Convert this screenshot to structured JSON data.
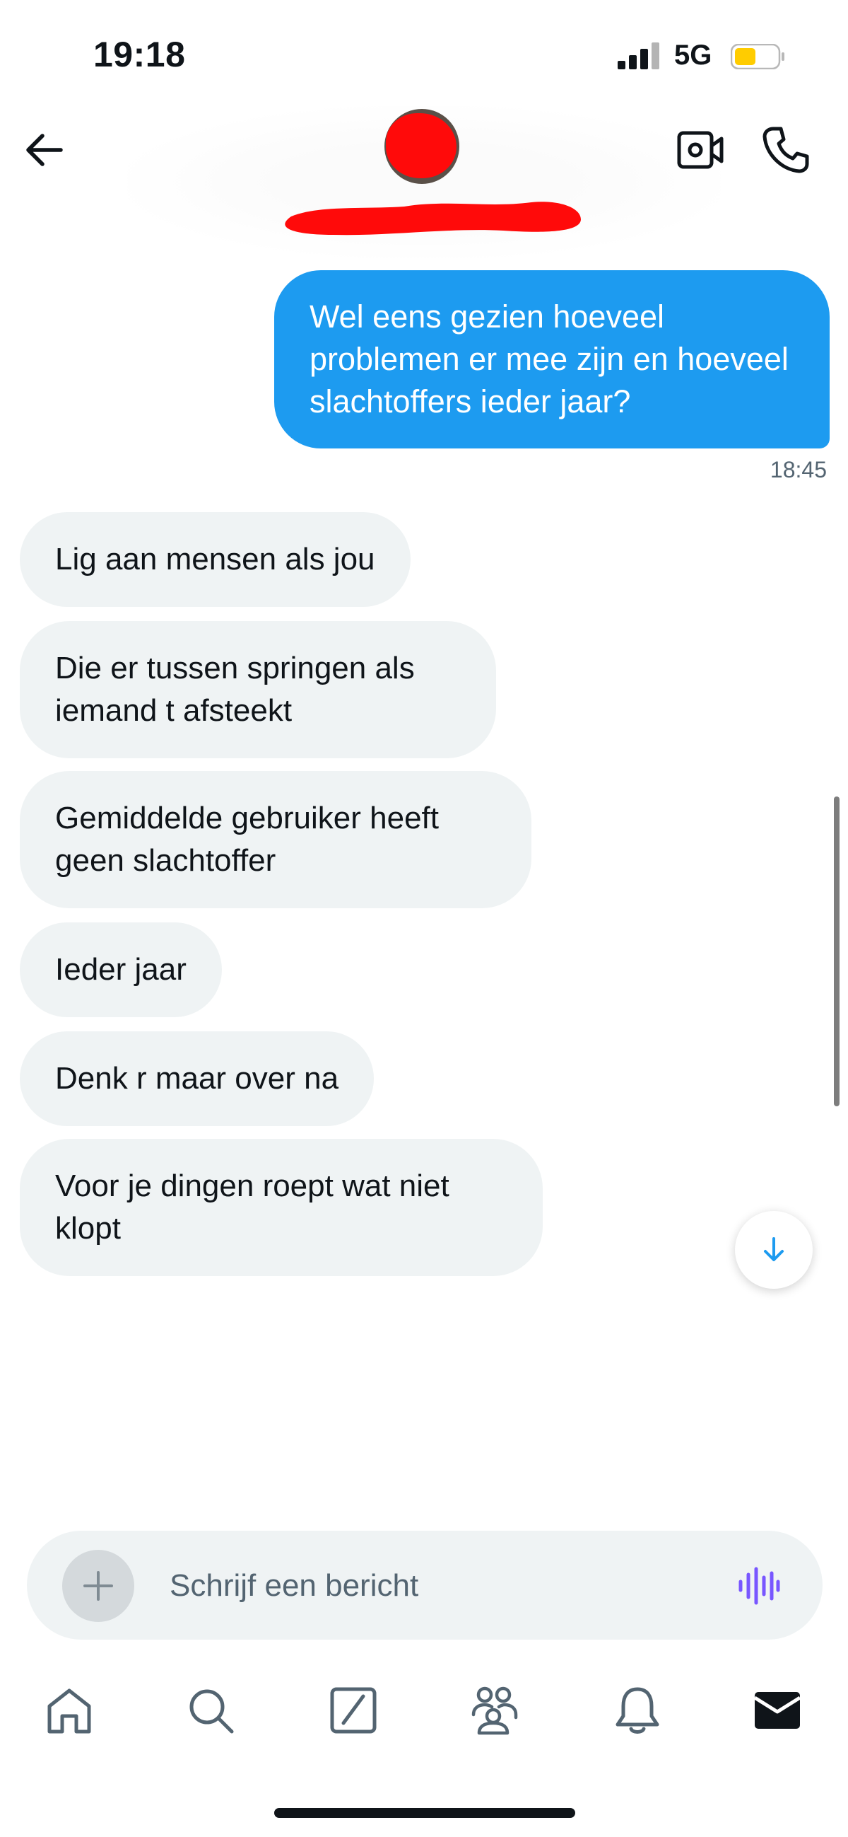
{
  "status_bar": {
    "time": "19:18",
    "network": "5G",
    "battery_level": 0.5,
    "battery_color": "#ffcc00"
  },
  "header": {
    "back_icon": "arrow-left-icon",
    "video_icon": "video-camera-icon",
    "call_icon": "phone-icon"
  },
  "messages": [
    {
      "direction": "sent",
      "text": "Wel eens gezien hoeveel problemen er mee zijn en hoeveel slachtoffers ieder jaar?",
      "time": "18:45"
    },
    {
      "direction": "received",
      "text": "Lig aan mensen als jou"
    },
    {
      "direction": "received",
      "text": "Die er tussen springen als iemand t afsteekt"
    },
    {
      "direction": "received",
      "text": "Gemiddelde gebruiker heeft geen slachtoffer"
    },
    {
      "direction": "received",
      "text": "Ieder jaar"
    },
    {
      "direction": "received",
      "text": "Denk r maar over na"
    },
    {
      "direction": "received",
      "text": "Voor je dingen roept wat niet klopt"
    }
  ],
  "composer": {
    "placeholder": "Schrijf een bericht",
    "value": "",
    "add_icon": "plus-icon",
    "voice_icon": "voice-waveform-icon"
  },
  "bottom_nav": {
    "items": [
      {
        "icon": "home-icon"
      },
      {
        "icon": "search-icon"
      },
      {
        "icon": "grok-icon"
      },
      {
        "icon": "communities-icon"
      },
      {
        "icon": "bell-icon"
      },
      {
        "icon": "mail-icon"
      }
    ]
  },
  "colors": {
    "accent": "#1d9bf0",
    "received_bubble": "#eff3f4",
    "secondary_text": "#536471",
    "voice_icon": "#7856ff"
  }
}
